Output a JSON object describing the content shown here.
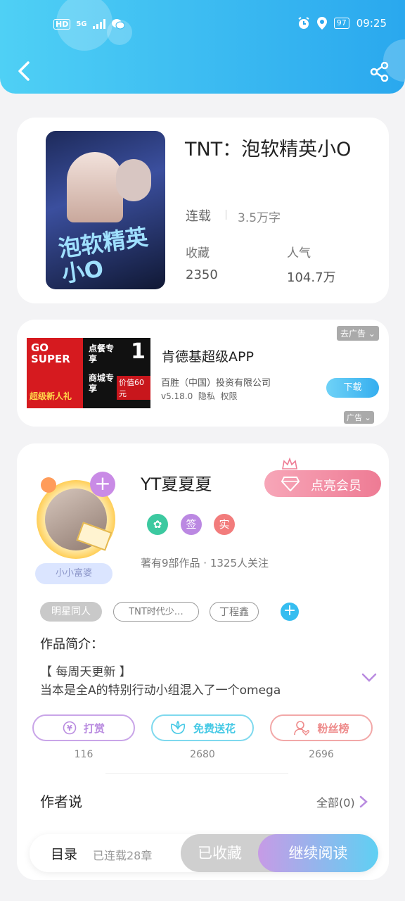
{
  "status_bar": {
    "hd": "HD",
    "net": "5G",
    "battery": "97",
    "time": "09:25"
  },
  "book": {
    "title": "TNT：泡软精英小O",
    "status": "连载",
    "word_count": "3.5万字",
    "fav_label": "收藏",
    "fav_value": "2350",
    "pop_label": "人气",
    "pop_value": "104.7万",
    "cover_text": "泡软精英小O"
  },
  "ad": {
    "go_ad": "去广告 ⌄",
    "title": "肯德基超级APP",
    "company": "百胜（中国）投资有限公司",
    "meta": "v5.18.0  隐私  权限",
    "download": "下载",
    "ad_tag": "广告 ⌄",
    "img_text_1": "GO SUPER",
    "img_text_2": "点餐专享",
    "img_text_3": "商城专享",
    "img_text_4": "超级新人礼",
    "img_text_5": "价值60元",
    "img_text_6": "1"
  },
  "author": {
    "name": "YT夏夏夏",
    "vip_label": "点亮会员",
    "badge_sign": "签",
    "badge_real": "实",
    "stats": "著有9部作品 · 1325人关注",
    "nameplate": "小小富婆"
  },
  "tags": [
    "明星同人",
    "TNT时代少…",
    "丁程鑫"
  ],
  "intro": {
    "label": "作品简介：",
    "line1": "【 每周天更新 】",
    "line2": "当本是全A的特别行动小组混入了一个omega"
  },
  "actions": [
    {
      "label": "打赏",
      "count": "116",
      "color": "#b98be0"
    },
    {
      "label": "免费送花",
      "count": "2680",
      "color": "#45c9e5"
    },
    {
      "label": "粉丝榜",
      "count": "2696",
      "color": "#ee8a8a"
    }
  ],
  "author_says": {
    "label": "作者说",
    "all": "全部(0)"
  },
  "bottom": {
    "toc": "目录",
    "chapters": "已连载28章",
    "collected": "已收藏",
    "continue": "继续阅读"
  },
  "colors": {
    "header": "#2aa8ee",
    "accent": "#c98be6",
    "vip": "#ee7b94"
  }
}
